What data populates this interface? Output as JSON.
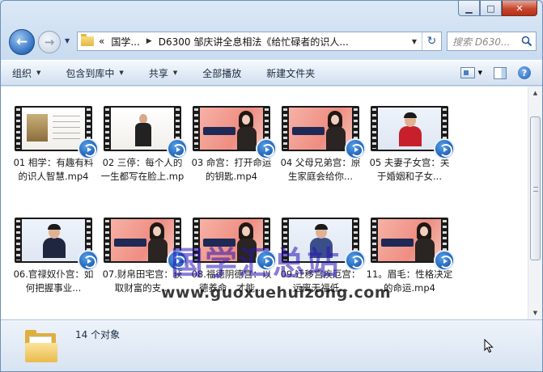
{
  "window": {
    "caption": {
      "minimize": "▁",
      "maximize": "□",
      "close": "✕"
    }
  },
  "address": {
    "prefix": "«",
    "crumbs": [
      "国学...",
      "D6300 邹庆讲全息相法《给忙碌者的识人..."
    ],
    "icon": "folder-icon"
  },
  "search": {
    "placeholder": "搜索 D630..."
  },
  "toolbar": {
    "items": [
      {
        "label": "组织",
        "dropdown": true
      },
      {
        "label": "包含到库中",
        "dropdown": true
      },
      {
        "label": "共享",
        "dropdown": true
      },
      {
        "label": "全部播放",
        "dropdown": false
      },
      {
        "label": "新建文件夹",
        "dropdown": false
      }
    ],
    "help": "?"
  },
  "files": [
    {
      "name": "01 相学：有趣有料的识人智慧.mp4",
      "thumb": "slide"
    },
    {
      "name": "02 三停：每个人的一生都写在脸上.mp4",
      "thumb": "suit"
    },
    {
      "name": "03 命宫：打开命运的钥匙.mp4",
      "thumb": "title"
    },
    {
      "name": "04 父母兄弟宫：原生家庭会给你...",
      "thumb": "title"
    },
    {
      "name": "05 夫妻子女宫：关于婚姻和子女...",
      "thumb": "portrait-red"
    },
    {
      "name": "06.官禄奴仆宫：如何把握事业...",
      "thumb": "portrait-blue"
    },
    {
      "name": "07.财帛田宅宫：获取财富的支...",
      "thumb": "title"
    },
    {
      "name": "08.福德阴德宫：以德养命，才能...",
      "thumb": "title"
    },
    {
      "name": "09.迁移宫疾厄宫：远离无福低...",
      "thumb": "portrait-blue"
    },
    {
      "name": "11。眉毛：性格决定的命运.mp4",
      "thumb": "title"
    }
  ],
  "watermark": {
    "cn": "国学汇总站",
    "url": "www.guoxuehuizong.com"
  },
  "status": {
    "count_text": "14 个对象"
  },
  "colors": {
    "accent": "#2f6fc0",
    "close": "#c7452c",
    "watermark": "#2814b4"
  }
}
